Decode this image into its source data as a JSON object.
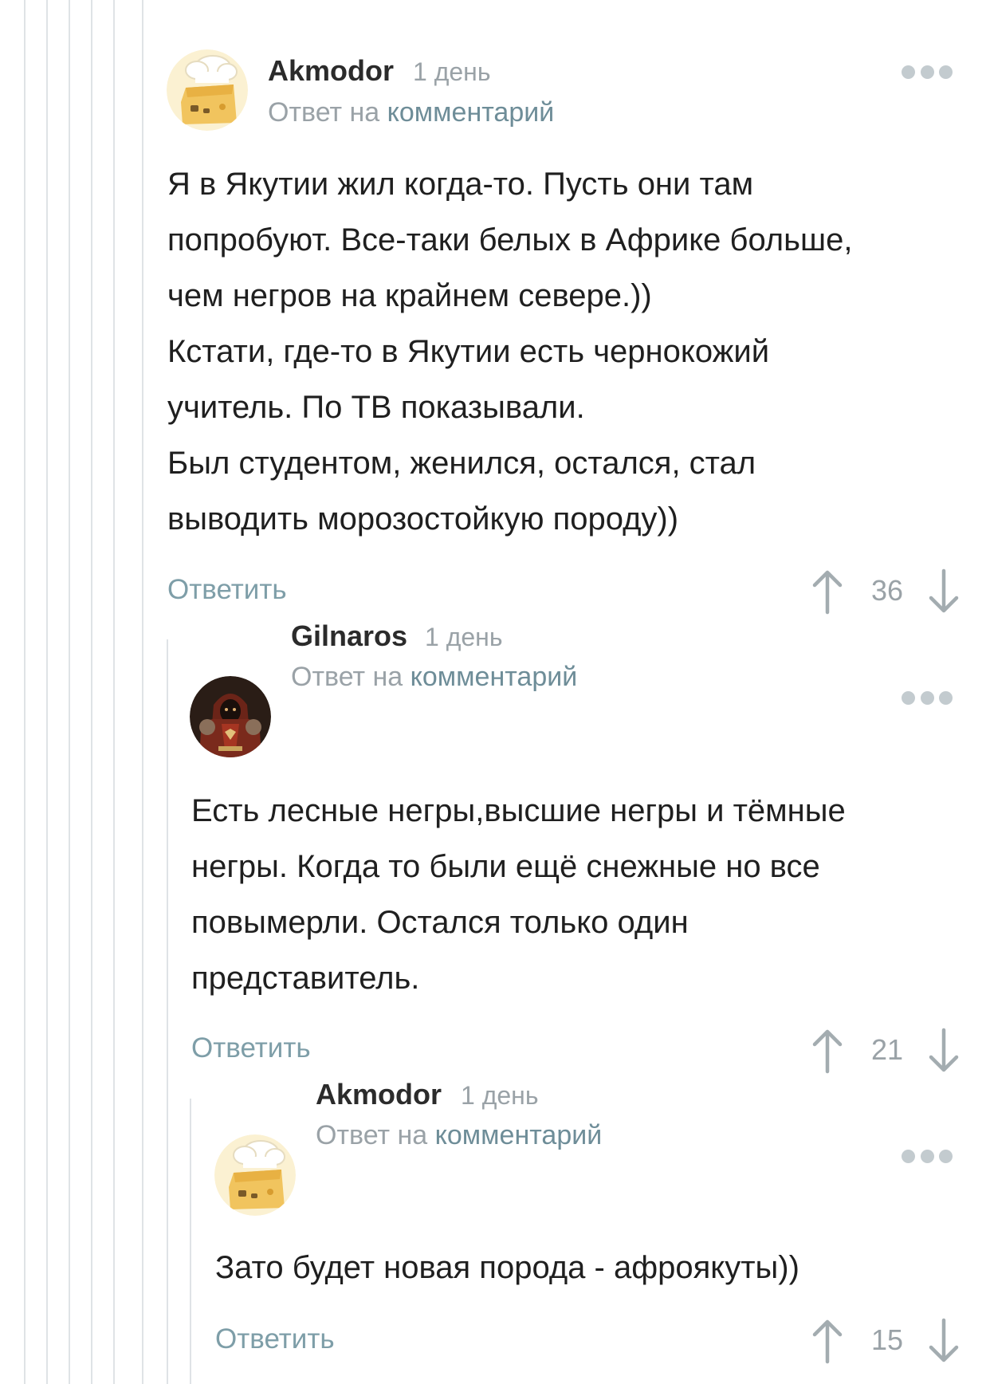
{
  "comments": [
    {
      "author": "Akmodor",
      "time": "1 день",
      "reply_prefix": "Ответ на",
      "reply_link": "комментарий",
      "avatar_icon": "chef-hat-cheese-avatar",
      "lines": [
        "Я в Якутии жил когда-то. Пусть они там",
        "попробуют. Все-таки белых в Африке больше,",
        "чем негров на крайнем севере.))",
        "Кстати, где-то в Якутии есть чернокожий",
        "учитель. По ТВ показывали.",
        "Был студентом, женился, остался, стал",
        "выводить морозостойкую породу))"
      ],
      "reply_label": "Ответить",
      "score": "36"
    },
    {
      "author": "Gilnaros",
      "time": "1 день",
      "reply_prefix": "Ответ на",
      "reply_link": "комментарий",
      "avatar_icon": "hooded-warrior-avatar",
      "lines": [
        "Есть лесные негры,высшие негры и тёмные",
        "негры. Когда то были ещё снежные но все",
        "повымерли. Остался только один",
        "представитель."
      ],
      "reply_label": "Ответить",
      "score": "21"
    },
    {
      "author": "Akmodor",
      "time": "1 день",
      "reply_prefix": "Ответ на",
      "reply_link": "комментарий",
      "avatar_icon": "chef-hat-cheese-avatar",
      "lines": [
        "Зато будет новая порода - афроякуты))"
      ],
      "reply_label": "Ответить",
      "score": "15"
    }
  ],
  "colors": {
    "accent_link": "#6e8d98",
    "muted": "#9aa2a7",
    "thread_line": "#dfe3e6"
  }
}
